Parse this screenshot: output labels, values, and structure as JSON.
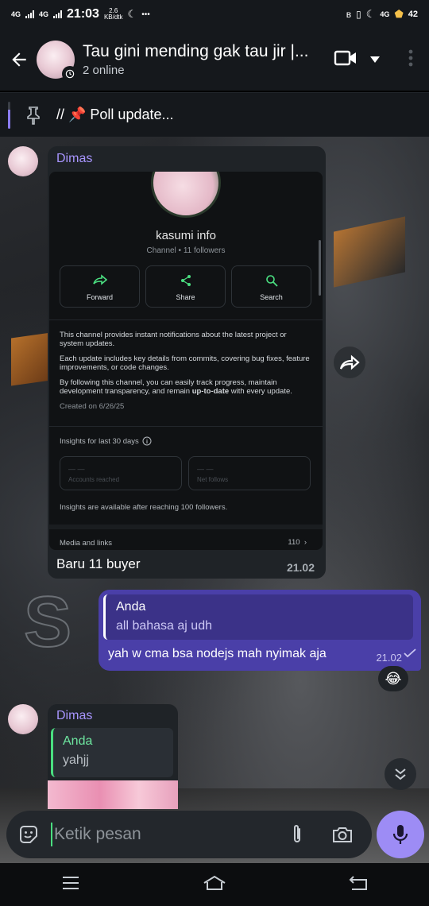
{
  "status_bar": {
    "net1": "4G",
    "net2": "4G",
    "time": "21:03",
    "speed_value": "2.6",
    "speed_unit": "KB/dtk",
    "more": "•••",
    "net3": "4G",
    "battery": "42"
  },
  "header": {
    "title": "Tau gini mending gak tau jir |...",
    "subtitle": "2 online"
  },
  "pinned": {
    "text": "// 📌 Poll update..."
  },
  "messages": {
    "first": {
      "sender": "Dimas",
      "caption": "Baru 11 buyer",
      "time": "21.02",
      "screenshot": {
        "channel_name": "kasumi info",
        "channel_meta": "Channel • 11 followers",
        "buttons": [
          "Forward",
          "Share",
          "Search"
        ],
        "desc1": "This channel provides instant notifications about the latest project or system updates.",
        "desc2": "Each update includes key details from commits, covering bug fixes, feature improvements, or code changes.",
        "desc3_pre": "By following this channel, you can easily track progress, maintain development transparency, and remain ",
        "desc3_bold": "up-to-date",
        "desc3_post": " with every update.",
        "created": "Created on 6/26/25",
        "insights": "Insights for last 30 days",
        "box1_dash": "— —",
        "box1_label": "Accounts reached",
        "box2_dash": "— —",
        "box2_label": "Net follows",
        "insights_note": "Insights are available after reaching 100 followers.",
        "media": "Media and links",
        "media_count": "110"
      }
    },
    "outgoing": {
      "quote_name": "Anda",
      "quote_text": "all bahasa aj udh",
      "text": "yah w cma bsa nodejs mah nyimak aja",
      "time": "21.02",
      "reaction": "😂"
    },
    "second": {
      "sender": "Dimas",
      "quote_name": "Anda",
      "quote_text": "yahjj"
    }
  },
  "input": {
    "placeholder": "Ketik pesan"
  },
  "colors": {
    "accent": "#9d8cf5",
    "outgoing_bubble": "#4a3fa8",
    "quote_green": "#4ade80"
  }
}
